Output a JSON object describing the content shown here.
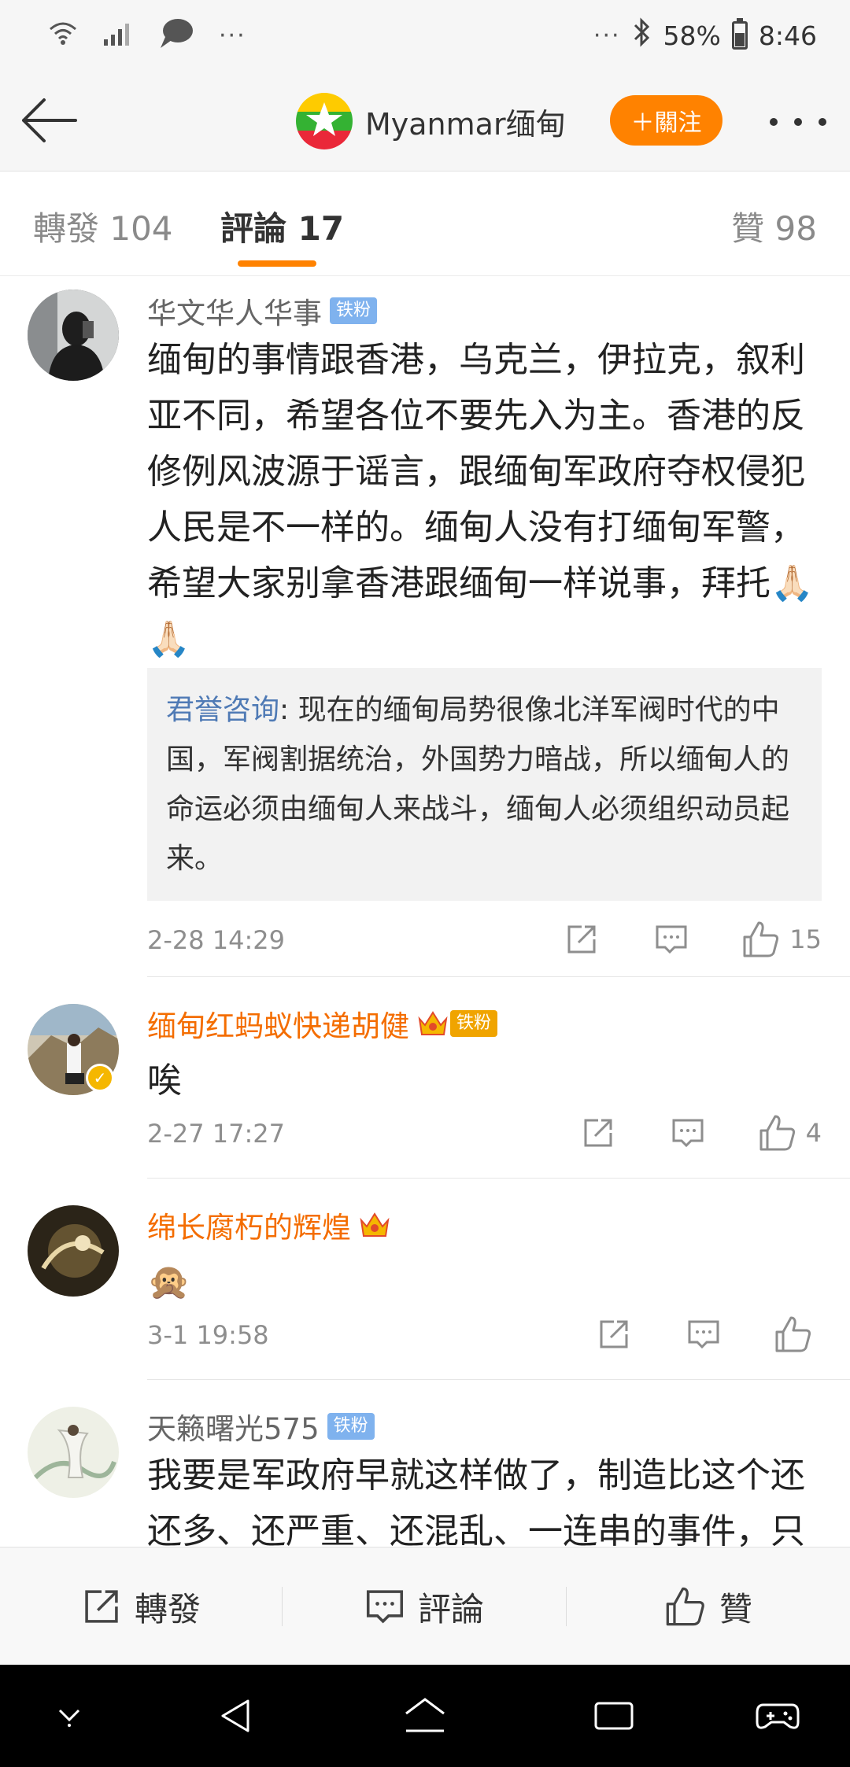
{
  "status_bar": {
    "battery": "58%",
    "time": "8:46",
    "more": "···"
  },
  "header": {
    "title": "Myanmar缅甸",
    "follow_label": "＋關注"
  },
  "tabs": {
    "repost": "轉發 104",
    "comments": "評論 17",
    "likes": "贊 98"
  },
  "comments": [
    {
      "user": "华文华人华事",
      "badge": "铁粉",
      "text": "缅甸的事情跟香港，乌克兰，伊拉克，叙利亚不同，希望各位不要先入为主。香港的反修例风波源于谣言，跟缅甸军政府夺权侵犯人民是不一样的。缅甸人没有打缅甸军警，希望大家别拿香港跟缅甸一样说事，拜托🙏🏻🙏🏻",
      "reply_user": "君誉咨询",
      "reply_text": ": 现在的缅甸局势很像北洋军阀时代的中国，军阀割据统治，外国势力暗战，所以缅甸人的命运必须由缅甸人来战斗，缅甸人必须组织动员起来。",
      "time": "2-28 14:29",
      "likes": "15"
    },
    {
      "user": "缅甸红蚂蚁快递胡健",
      "badge": "铁粉",
      "text": "唉",
      "time": "2-27 17:27",
      "likes": "4"
    },
    {
      "user": "绵长腐朽的辉煌",
      "text": "🙊",
      "time": "3-1 19:58",
      "likes": ""
    },
    {
      "user": "天籁曙光575",
      "badge": "铁粉",
      "text": "我要是军政府早就这样做了，制造比这个还还多、还严重、还混乱、一连串的事件，只"
    }
  ],
  "toolbar": {
    "repost": "轉發",
    "comment": "評論",
    "like": "贊"
  },
  "colors": {
    "accent": "#ff8200",
    "vip_name": "#f46d00",
    "reply_name": "#4f7ab5",
    "fan_badge": "#7fb2ee"
  },
  "icons": [
    "wifi-icon",
    "signal-icon",
    "chat-bubble-icon",
    "bluetooth-icon",
    "battery-icon",
    "back-arrow-icon",
    "myanmar-flag-icon",
    "more-icon",
    "share-icon",
    "comment-icon",
    "like-icon",
    "crown-icon",
    "verified-icon"
  ]
}
